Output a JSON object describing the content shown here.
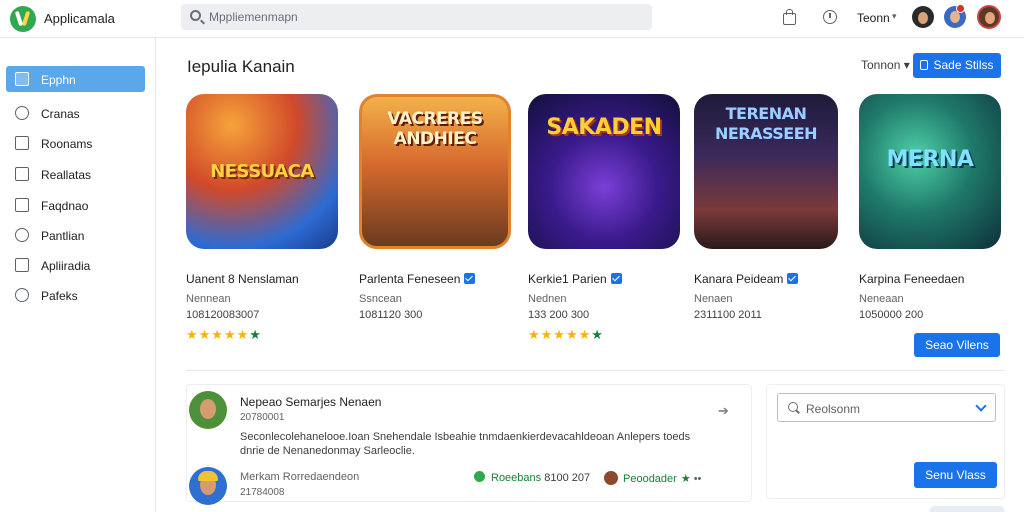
{
  "header": {
    "app_title": "Applicamala",
    "search_placeholder": "Mppliemenmapn",
    "user_name": "Teonn",
    "caret": "▾"
  },
  "sidebar": {
    "items": [
      {
        "label": "Epphn",
        "icon": "home-icon",
        "active": true
      },
      {
        "label": "Cranas",
        "icon": "games-icon"
      },
      {
        "label": "Roonams",
        "icon": "list-icon"
      },
      {
        "label": "Reallatas",
        "icon": "doc-icon"
      },
      {
        "label": "Faqdnao",
        "icon": "card-icon"
      },
      {
        "label": "Pantlian",
        "icon": "clock-icon"
      },
      {
        "label": "Apliiradia",
        "icon": "chart-icon"
      },
      {
        "label": "Pafeks",
        "icon": "person-icon"
      }
    ]
  },
  "main": {
    "section_title": "Iepulia Kanain",
    "sort_label": "Tonnon ▾",
    "top_button_label": "Sade Stilss",
    "apps": [
      {
        "thumb_title": "NESSUACA",
        "name": "Uanent 8 Nenslaman",
        "verified": false,
        "developer": "Nennean",
        "stats": "108120083007",
        "rating": 5
      },
      {
        "thumb_title": "VACRERES ANDHIEC",
        "name": "Parlenta Feneseen",
        "verified": true,
        "developer": "Ssncean",
        "stats": "1081120 300",
        "rating": null
      },
      {
        "thumb_title": "SAKADEN",
        "name": "Kerkie1 Parien",
        "verified": true,
        "developer": "Nednen",
        "stats": "133 200 300",
        "rating": 5
      },
      {
        "thumb_title": "TERENAN NERASSEEH",
        "name": "Kanara Peideam",
        "verified": true,
        "developer": "Nenaen",
        "stats": "2311100 2011",
        "rating": null
      },
      {
        "thumb_title": "MERNA",
        "name": "Karpina Feneedaen",
        "verified": false,
        "developer": "Neneaan",
        "stats": "1050000 200",
        "rating": null
      }
    ],
    "more_button_label": "Seao Vilens"
  },
  "reviews": {
    "r1_name": "Nepeao Semarjes Nenaen",
    "r1_date": "20780001",
    "r1_text": "Seconlecolehanelooe.Ioan Snehendale Isbeahie tnmdaenkierdevacahldeoan Anlepers toeds  dnrie de Nenanedonmay Sarleoclie.",
    "share_icon": "➔",
    "r2_name": "Merkam Rorredaendeon",
    "r2_date": "21784008",
    "chip1_label": "Roeebans",
    "chip1_value": "8100  207",
    "chip2_label": "Peoodader",
    "chip2_more": "••"
  },
  "filter": {
    "select_value": "Reolsonm",
    "button_label": "Senu Vlass"
  },
  "colors": {
    "accent": "#1a73e8",
    "sidebar_active": "#5aa7ea",
    "star": "#f4b400",
    "green": "#188038"
  }
}
